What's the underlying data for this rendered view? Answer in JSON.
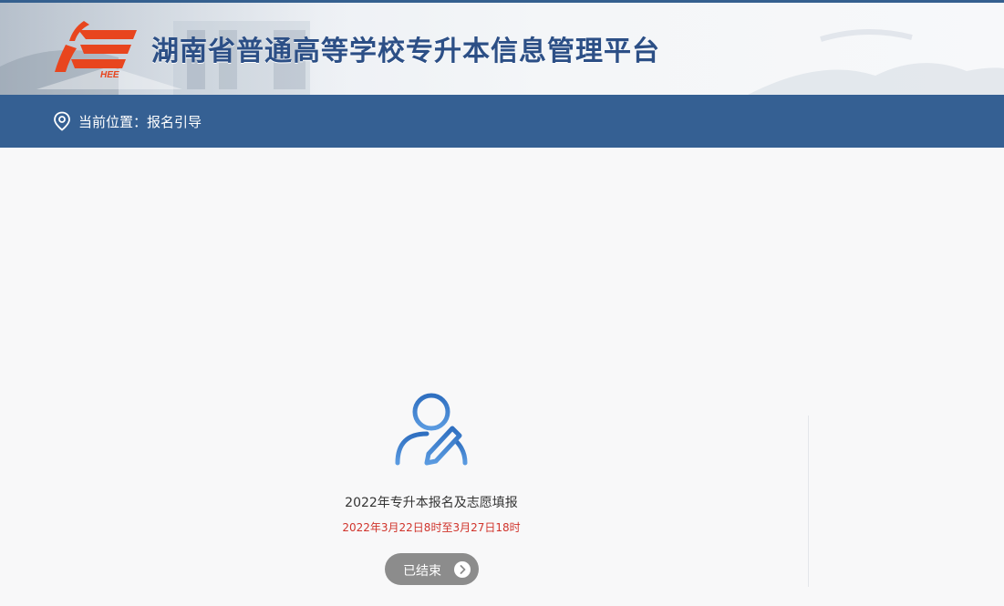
{
  "header": {
    "site_title": "湖南省普通高等学校专升本信息管理平台",
    "logo_text": "HEE"
  },
  "location_bar": {
    "icon": "location-pin-icon",
    "text": "当前位置：报名引导"
  },
  "card": {
    "icon": "user-edit-icon",
    "title": "2022年专升本报名及志愿填报",
    "time_range": "2022年3月22日8时至3月27日18时",
    "status_label": "已结束",
    "status_icon": "chevron-right-icon"
  },
  "colors": {
    "brand_blue": "#356093",
    "title_blue": "#2c4f86",
    "logo_red": "#e8451e",
    "time_red": "#d0342c",
    "button_gray": "#8c8c8c"
  }
}
